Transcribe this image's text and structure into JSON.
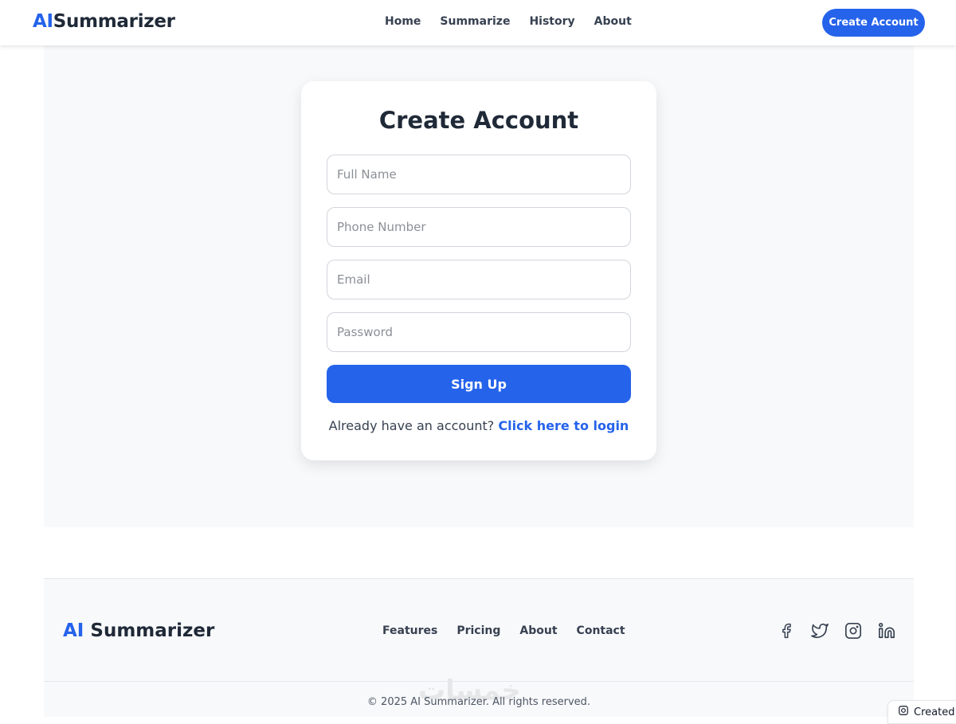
{
  "header": {
    "logo_ai": "AI",
    "logo_rest": "Summarizer",
    "nav": [
      "Home",
      "Summarize",
      "History",
      "About"
    ],
    "cta_label": "Create Account"
  },
  "form": {
    "title": "Create Account",
    "full_name_placeholder": "Full Name",
    "phone_placeholder": "Phone Number",
    "email_placeholder": "Email",
    "password_placeholder": "Password",
    "submit_label": "Sign Up",
    "login_prompt": "Already have an account?",
    "login_link": "Click here to login"
  },
  "footer": {
    "logo_ai": "AI",
    "logo_rest": "Summarizer",
    "links": [
      "Features",
      "Pricing",
      "About",
      "Contact"
    ],
    "socials": [
      "facebook-icon",
      "twitter-icon",
      "instagram-icon",
      "linkedin-icon"
    ],
    "copyright": "© 2025 AI Summarizer. All rights reserved.",
    "watermark": "خمسات"
  },
  "badge": {
    "label": "Created"
  },
  "colors": {
    "accent": "#2563eb",
    "text": "#1f2937",
    "band": "#f8f9fb"
  }
}
